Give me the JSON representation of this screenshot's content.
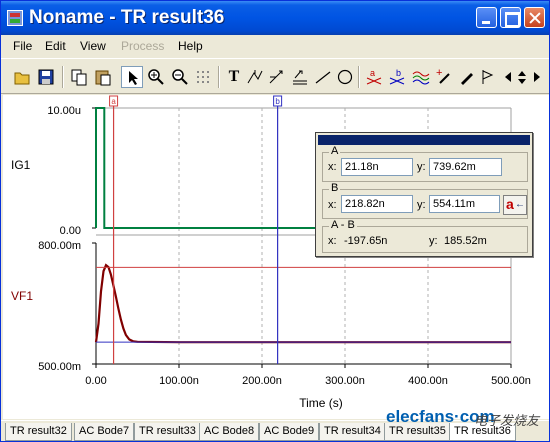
{
  "window": {
    "title": "Noname - TR result36"
  },
  "menu": [
    {
      "label": "File",
      "key": "F",
      "rest": "ile",
      "enabled": true
    },
    {
      "label": "Edit",
      "key": "E",
      "rest": "dit",
      "enabled": true
    },
    {
      "label": "View",
      "key": "V",
      "rest": "iew",
      "enabled": true
    },
    {
      "label": "Process",
      "key": "P",
      "rest": "rocess",
      "enabled": false
    },
    {
      "label": "Help",
      "key": "H",
      "rest": "elp",
      "enabled": true
    }
  ],
  "toolbar": {
    "text_tool_label": "T",
    "icons": [
      "open-icon",
      "save-icon",
      "copy-icon",
      "paste-icon",
      "pointer-icon",
      "zoom-in-icon",
      "zoom-out-icon",
      "grid-icon",
      "text-icon",
      "line-icons",
      "cursor-a-icon",
      "cursor-b-icon",
      "curve-icon",
      "pen-icon",
      "flag-icon",
      "arrow-left-icon",
      "arrow-updown-icon",
      "arrow-right-icon"
    ]
  },
  "plot": {
    "upper": {
      "name": "IG1",
      "y_top": "10.00u",
      "y_bottom": "0.00"
    },
    "lower": {
      "name": "VF1",
      "y_top": "800.00m",
      "y_bottom": "500.00m"
    },
    "x_ticks": [
      "0.00",
      "100.00n",
      "200.00n",
      "300.00n",
      "400.00n",
      "500.00n"
    ],
    "x_label": "Time (s)",
    "cursor_a_label": "a",
    "cursor_b_label": "b"
  },
  "chart_data": {
    "type": "line",
    "xlabel": "Time (s)",
    "xlim": [
      0,
      5e-07
    ],
    "panels": [
      {
        "name": "IG1",
        "ylim": [
          0,
          1e-05
        ],
        "series": [
          {
            "name": "IG1",
            "color": "#008040",
            "x": [
              0,
              0,
              1e-08,
              1e-08,
              5e-07
            ],
            "y": [
              0,
              1e-05,
              1e-05,
              0,
              0
            ]
          }
        ]
      },
      {
        "name": "VF1",
        "ylim": [
          0.5,
          0.8
        ],
        "series": [
          {
            "name": "VF1",
            "color": "#800000",
            "x": [
              0,
              3e-09,
              6e-09,
              9e-09,
              1.2e-08,
              1.5e-08,
              1.8e-08,
              2.1e-08,
              2.4e-08,
              2.7e-08,
              3e-08,
              3.3e-08,
              3.6e-08,
              4e-08,
              4.5e-08,
              5e-08,
              1e-07,
              5e-07
            ],
            "y": [
              0.554,
              0.6,
              0.68,
              0.73,
              0.745,
              0.74,
              0.722,
              0.695,
              0.667,
              0.637,
              0.61,
              0.588,
              0.572,
              0.561,
              0.556,
              0.555,
              0.554,
              0.554
            ]
          }
        ]
      }
    ],
    "cursors": {
      "a_x": 2.118e-08,
      "b_x": 2.1882e-07
    }
  },
  "colors": {
    "ig1_trace": "#008040",
    "vf1_trace": "#800000",
    "cursor_a": "#d04040",
    "cursor_b": "#3030c0",
    "baseline": "#c0c000"
  },
  "cursor_panel": {
    "group_a": "A",
    "group_b": "B",
    "group_diff": "A - B",
    "x_label": "x:",
    "y_label": "y:",
    "a_x": "21.18n",
    "a_y": "739.62m",
    "b_x": "218.82n",
    "b_y": "554.11m",
    "diff_x": "-197.65n",
    "diff_y": "185.52m",
    "swap_button": "a"
  },
  "tabs": [
    "TR result32",
    "AC Bode7",
    "TR result33",
    "AC Bode8",
    "AC Bode9",
    "TR result34",
    "TR result35",
    "TR result36"
  ],
  "watermark": {
    "brand": "elecfans·com",
    "cn": "电子发烧友"
  }
}
